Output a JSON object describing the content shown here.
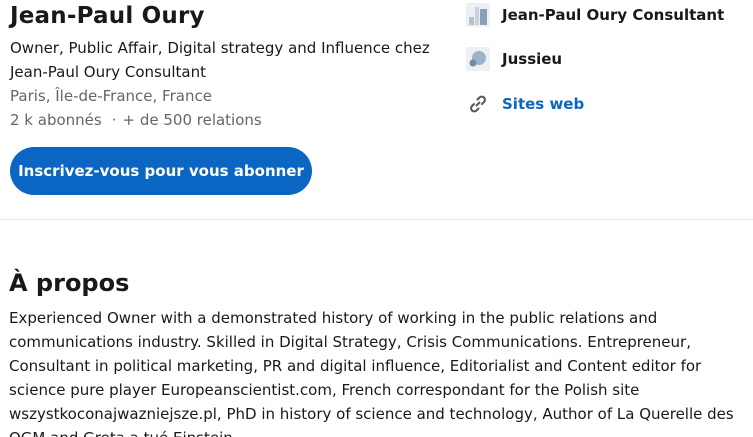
{
  "profile": {
    "name": "Jean-Paul Oury",
    "headline": "Owner, Public Affair, Digital strategy and Influence chez Jean-Paul Oury Consultant",
    "location": "Paris, Île-de-France, France",
    "followers": "2 k abonnés",
    "separator": "·",
    "connections": "+ de 500 relations",
    "cta_label": "Inscrivez-vous pour vous abonner"
  },
  "sidebar": {
    "company": {
      "label": "Jean-Paul Oury Consultant",
      "icon": "company-logo-icon"
    },
    "school": {
      "label": "Jussieu",
      "icon": "school-logo-icon"
    },
    "websites": {
      "label": "Sites web",
      "icon": "link-icon"
    }
  },
  "about": {
    "title": "À propos",
    "text": "Experienced Owner with a demonstrated history of working in the public relations and communications industry. Skilled in Digital Strategy, Crisis Communications. Entrepreneur, Consultant in political marketing, PR and digital influence, Editorialist and Content editor for science pure player Europeanscientist.com, French correspondant for the Polish site wszystkoconajwazniejsze.pl, PhD in history of science and technology, Author of La Querelle des OGM and Greta a tué Einstein"
  },
  "colors": {
    "accent": "#0a66c2",
    "text": "#191919",
    "muted": "#666666",
    "divider": "#e8e8e8"
  }
}
